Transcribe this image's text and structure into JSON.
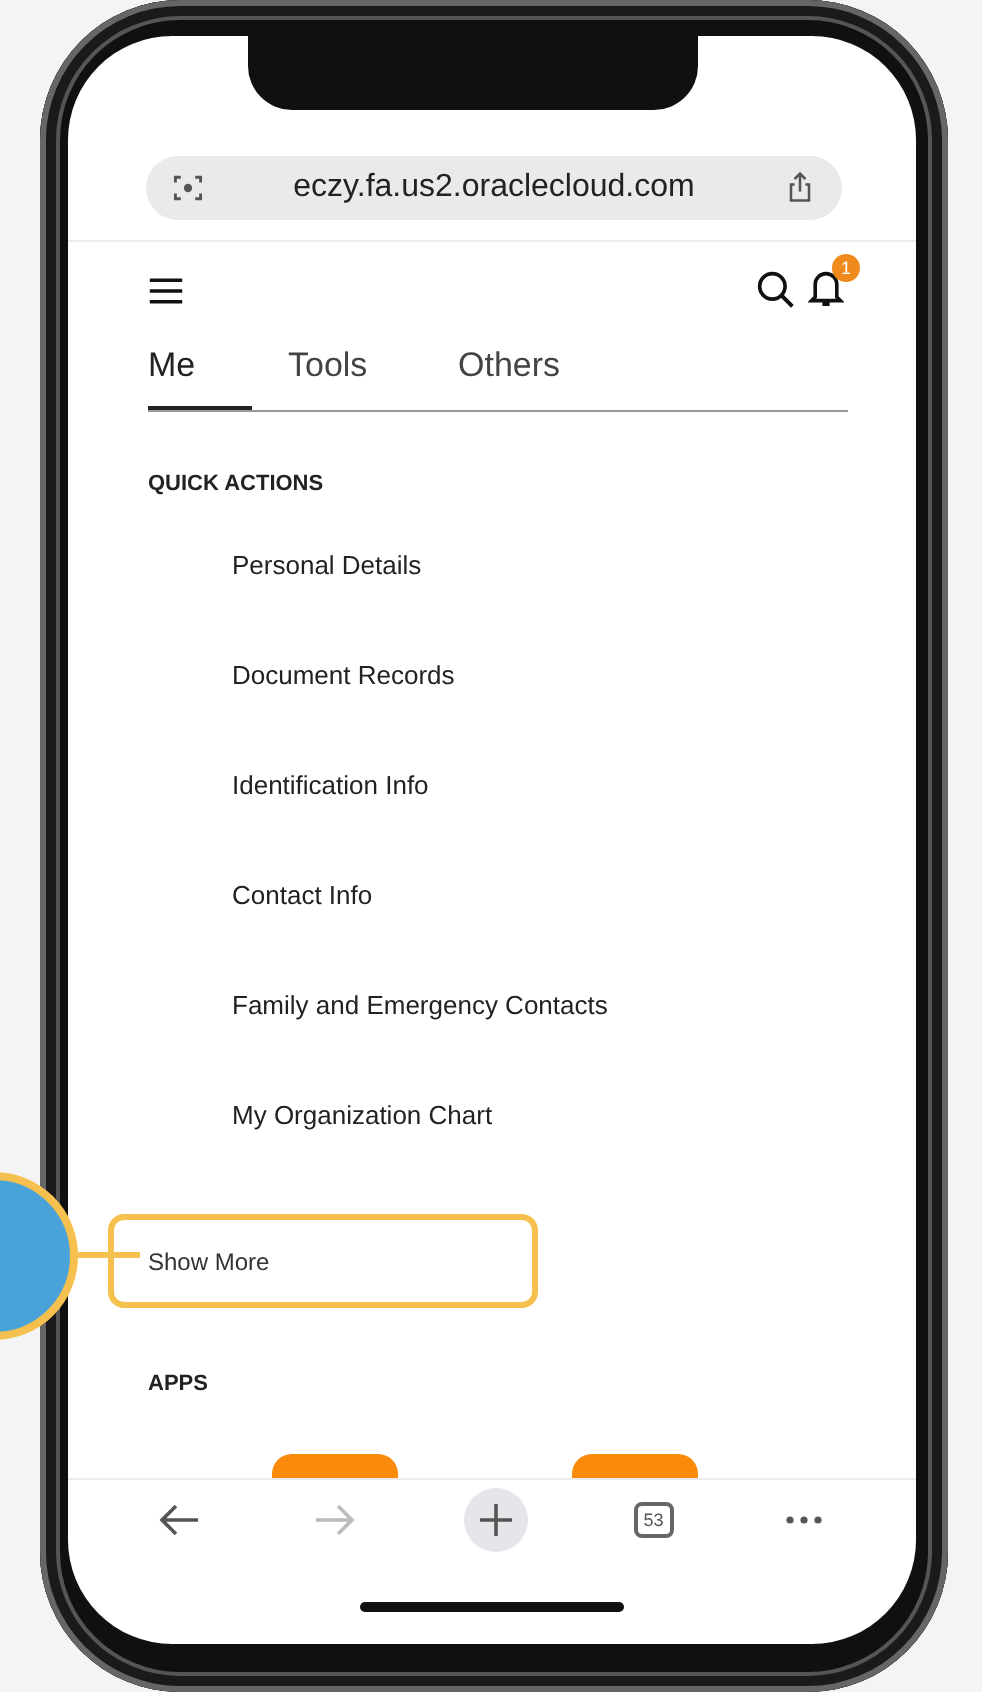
{
  "browser": {
    "url": "eczy.fa.us2.oraclecloud.com"
  },
  "header": {
    "notification_count": "1"
  },
  "tabs": [
    {
      "label": "Me",
      "selected": true
    },
    {
      "label": "Tools",
      "selected": false
    },
    {
      "label": "Others",
      "selected": false
    }
  ],
  "quick_actions": {
    "title": "QUICK ACTIONS",
    "items": [
      "Personal Details",
      "Document Records",
      "Identification Info",
      "Contact Info",
      "Family and Emergency Contacts",
      "My Organization Chart"
    ]
  },
  "show_more": "Show More",
  "apps": {
    "title": "APPS"
  },
  "toolbar": [
    {
      "kind": "back",
      "disabled": false
    },
    {
      "kind": "forward",
      "disabled": true
    },
    {
      "kind": "new-tab",
      "disabled": false
    },
    {
      "kind": "tabs",
      "label": "53",
      "disabled": false
    },
    {
      "kind": "more",
      "disabled": false
    }
  ]
}
